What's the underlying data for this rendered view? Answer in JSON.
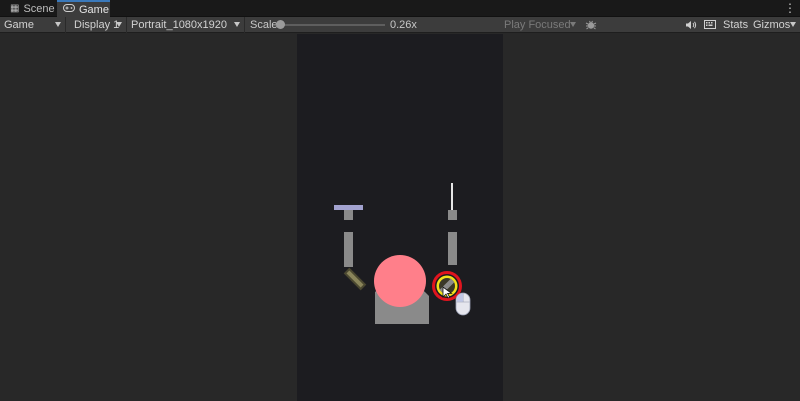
{
  "tabs": [
    {
      "label": "Scene",
      "icon": "grid-icon",
      "active": false
    },
    {
      "label": "Game",
      "icon": "gamepad-icon",
      "active": true
    }
  ],
  "toolbar": {
    "view_mode": "Game",
    "display": "Display 1",
    "resolution": "Portrait_1080x1920",
    "scale_label": "Scale",
    "scale_value": "0.26x",
    "play_mode": "Play Focused",
    "stats_label": "Stats",
    "gizmos_label": "Gizmos"
  },
  "colors": {
    "editor_bg": "#282828",
    "toolbar_bg": "#3c3c3c",
    "game_bg": "#1c1c20",
    "body_pink": "#ff7f8a",
    "arm_gray": "#8a8a8a",
    "highlight_red": "#e0141e",
    "highlight_yellow": "#f2e21a",
    "lamp_lavender": "#a2a2cf"
  }
}
